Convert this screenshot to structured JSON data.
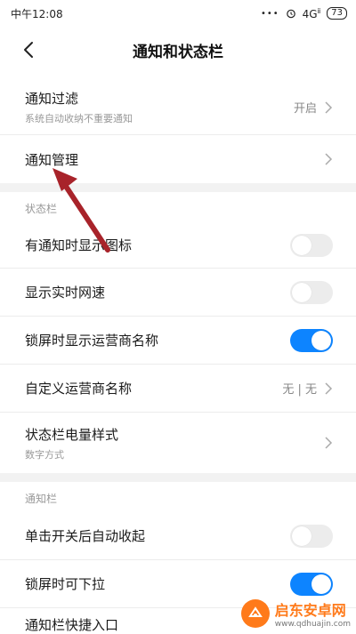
{
  "status_bar": {
    "time": "中午12:08",
    "signal_dots": "•••",
    "alarm_icon": "alarm-icon",
    "network": "4G",
    "network_sub": "ⅱ",
    "battery": "73"
  },
  "header": {
    "title": "通知和状态栏",
    "back_icon": "chevron-left-icon"
  },
  "rows": {
    "filter": {
      "title": "通知过滤",
      "subtitle": "系统自动收纳不重要通知",
      "value": "开启"
    },
    "manage": {
      "title": "通知管理"
    }
  },
  "sections": {
    "status_bar_label": "状态栏",
    "notification_bar_label": "通知栏"
  },
  "status_items": {
    "show_icon": {
      "title": "有通知时显示图标",
      "on": false
    },
    "net_speed": {
      "title": "显示实时网速",
      "on": false
    },
    "carrier_lock": {
      "title": "锁屏时显示运营商名称",
      "on": true
    },
    "custom_carrier": {
      "title": "自定义运营商名称",
      "value": "无 | 无"
    },
    "battery_style": {
      "title": "状态栏电量样式",
      "subtitle": "数字方式"
    }
  },
  "notif_items": {
    "auto_collapse": {
      "title": "单击开关后自动收起",
      "on": false
    },
    "lock_pull": {
      "title": "锁屏时可下拉",
      "on": true
    },
    "quick_entry": {
      "title": "通知栏快捷入口"
    }
  },
  "colors": {
    "accent": "#0d84ff",
    "annotation_arrow": "#a8232a"
  },
  "watermark": {
    "title": "启东安卓网",
    "url": "www.qdhuajin.com"
  }
}
